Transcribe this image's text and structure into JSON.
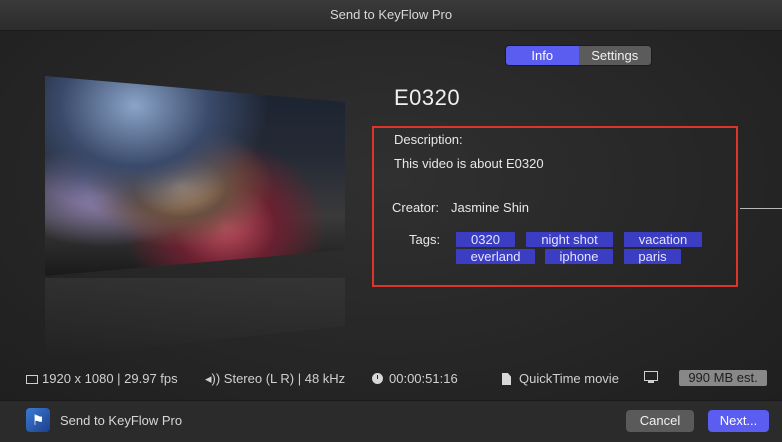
{
  "window": {
    "title": "Send to KeyFlow Pro"
  },
  "tabs": [
    {
      "label": "Info",
      "active": true
    },
    {
      "label": "Settings",
      "active": false
    }
  ],
  "clip": {
    "title": "E0320",
    "description_label": "Description:",
    "description": "This video is about E0320",
    "creator_label": "Creator:",
    "creator": "Jasmine Shin",
    "tags_label": "Tags:",
    "tags": [
      "0320",
      "night shot",
      "vacation",
      "everland",
      "iphone",
      "paris"
    ]
  },
  "media_info": {
    "resolution": "1920 x 1080 | 29.97 fps",
    "audio": "Stereo (L R) | 48 kHz",
    "duration": "00:00:51:16",
    "format": "QuickTime movie",
    "size_estimate": "990 MB est."
  },
  "footer": {
    "app_name": "Send to KeyFlow Pro",
    "cancel_label": "Cancel",
    "next_label": "Next..."
  },
  "colors": {
    "accent": "#5a5df0",
    "tag_bg": "#3b3dc2",
    "highlight_box": "#e0332c"
  }
}
